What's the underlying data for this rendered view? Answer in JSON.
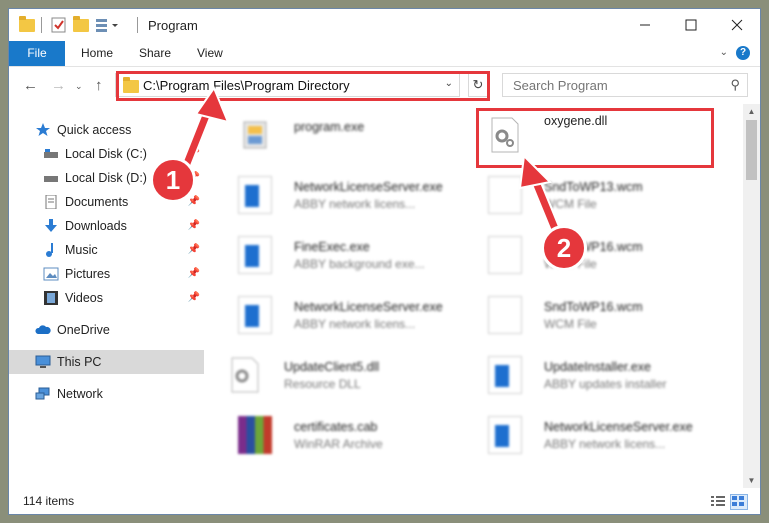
{
  "window": {
    "title": "Program"
  },
  "ribbon": {
    "tabs": [
      "File",
      "Home",
      "Share",
      "View"
    ]
  },
  "address": {
    "path": "C:\\Program Files\\Program Directory"
  },
  "search": {
    "placeholder": "Search Program"
  },
  "nav": {
    "items": [
      {
        "label": "Quick access",
        "icon": "star-icon"
      },
      {
        "label": "Local Disk (C:)",
        "icon": "drive-icon",
        "pinned": true
      },
      {
        "label": "Local Disk (D:)",
        "icon": "drive-icon",
        "pinned": true
      },
      {
        "label": "Documents",
        "icon": "documents-icon",
        "pinned": true
      },
      {
        "label": "Downloads",
        "icon": "download-icon",
        "pinned": true
      },
      {
        "label": "Music",
        "icon": "music-icon",
        "pinned": true
      },
      {
        "label": "Pictures",
        "icon": "pictures-icon",
        "pinned": true
      },
      {
        "label": "Videos",
        "icon": "videos-icon",
        "pinned": true
      },
      {
        "label": "OneDrive",
        "icon": "cloud-icon"
      },
      {
        "label": "This PC",
        "icon": "computer-icon",
        "selected": true
      },
      {
        "label": "Network",
        "icon": "network-icon"
      }
    ]
  },
  "files": [
    {
      "name": "program.exe",
      "desc": "",
      "icon": "installer-icon"
    },
    {
      "name": "oxygene.dll",
      "desc": "",
      "icon": "dll-icon",
      "highlighted": true
    },
    {
      "name": "NetworkLicenseServer.exe",
      "desc": "ABBY network licens...",
      "icon": "app-icon"
    },
    {
      "name": "SndToWP13.wcm",
      "desc": "WCM File",
      "icon": "document-icon"
    },
    {
      "name": "FineExec.exe",
      "desc": "ABBY background exe...",
      "icon": "app-icon"
    },
    {
      "name": "SndToWP16.wcm",
      "desc": "WCM File",
      "icon": "document-icon"
    },
    {
      "name": "NetworkLicenseServer.exe",
      "desc": "ABBY network licens...",
      "icon": "app-icon"
    },
    {
      "name": "SndToWP16.wcm",
      "desc": "WCM File",
      "icon": "document-icon"
    },
    {
      "name": "UpdateClient5.dll",
      "desc": "Resource DLL",
      "icon": "dll-icon"
    },
    {
      "name": "UpdateInstaller.exe",
      "desc": "ABBY updates installer",
      "icon": "app-icon"
    },
    {
      "name": "certificates.cab",
      "desc": "WinRAR Archive",
      "icon": "archive-icon"
    },
    {
      "name": "NetworkLicenseServer.exe",
      "desc": "ABBY network licens...",
      "icon": "app-icon"
    }
  ],
  "status": {
    "count": "114 items"
  },
  "annotations": {
    "step1": "1",
    "step2": "2"
  },
  "colors": {
    "accent": "#1979ca",
    "highlight": "#e5373c"
  }
}
